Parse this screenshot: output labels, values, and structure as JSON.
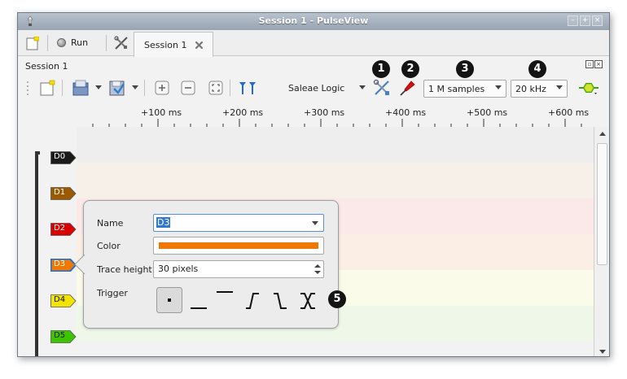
{
  "window": {
    "title": "Session 1 - PulseView",
    "controls": [
      "–",
      "+",
      "×"
    ]
  },
  "tabbar": {
    "run_label": "Run",
    "tab_label": "Session 1"
  },
  "session": {
    "label": "Session 1"
  },
  "toolbar": {
    "device": "Saleae Logic",
    "samples": "1 M samples",
    "rate": "20 kHz"
  },
  "callouts": [
    "1",
    "2",
    "3",
    "4",
    "5"
  ],
  "ruler": {
    "ticks": [
      "+100 ms",
      "+200 ms",
      "+300 ms",
      "+400 ms",
      "+500 ms",
      "+600 ms"
    ]
  },
  "channels": [
    {
      "name": "D0",
      "color": "#1a1a1a",
      "lane": "#eeeeee"
    },
    {
      "name": "D1",
      "color": "#9b5a00",
      "lane": "#f7f0e8"
    },
    {
      "name": "D2",
      "color": "#d80000",
      "lane": "#fbe9e9"
    },
    {
      "name": "D3",
      "color": "#f07800",
      "lane": "#fbefe5"
    },
    {
      "name": "D4",
      "color": "#f0e400",
      "lane": "#fbfbea"
    },
    {
      "name": "D5",
      "color": "#3cc400",
      "lane": "#eef7e8"
    }
  ],
  "popup": {
    "name_label": "Name",
    "name_value": "D3",
    "color_label": "Color",
    "color_value": "#f07800",
    "height_label": "Trace height",
    "height_value": "30 pixels",
    "trigger_label": "Trigger",
    "trigger_options": [
      "none",
      "low",
      "high",
      "rising",
      "falling",
      "change"
    ]
  }
}
